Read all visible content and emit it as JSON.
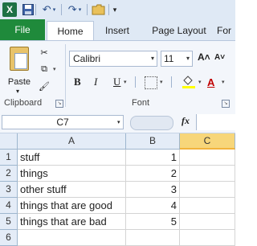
{
  "qat": {
    "app_icon": "X",
    "customize": "▾"
  },
  "tabs": [
    "File",
    "Home",
    "Insert",
    "Page Layout",
    "For"
  ],
  "clipboard": {
    "paste_label": "Paste",
    "group_label": "Clipboard"
  },
  "font": {
    "name": "Calibri",
    "size": "11",
    "grow": "A˄",
    "shrink": "A˅",
    "bold": "B",
    "italic": "I",
    "underline": "U",
    "font_color": "A",
    "group_label": "Font"
  },
  "formula_bar": {
    "name_box": "C7",
    "fx": "fx",
    "formula": ""
  },
  "sheet": {
    "columns": [
      "A",
      "B",
      "C"
    ],
    "selected_column": "C",
    "rows": [
      {
        "num": "1",
        "a": "stuff",
        "b": "1"
      },
      {
        "num": "2",
        "a": "things",
        "b": "2"
      },
      {
        "num": "3",
        "a": "other stuff",
        "b": "3"
      },
      {
        "num": "4",
        "a": "things that are good",
        "b": "4"
      },
      {
        "num": "5",
        "a": "things that are bad",
        "b": "5"
      },
      {
        "num": "6",
        "a": "",
        "b": ""
      }
    ]
  },
  "colors": {
    "file_tab": "#1f8a3b",
    "selected_header": "#f7d67a"
  }
}
